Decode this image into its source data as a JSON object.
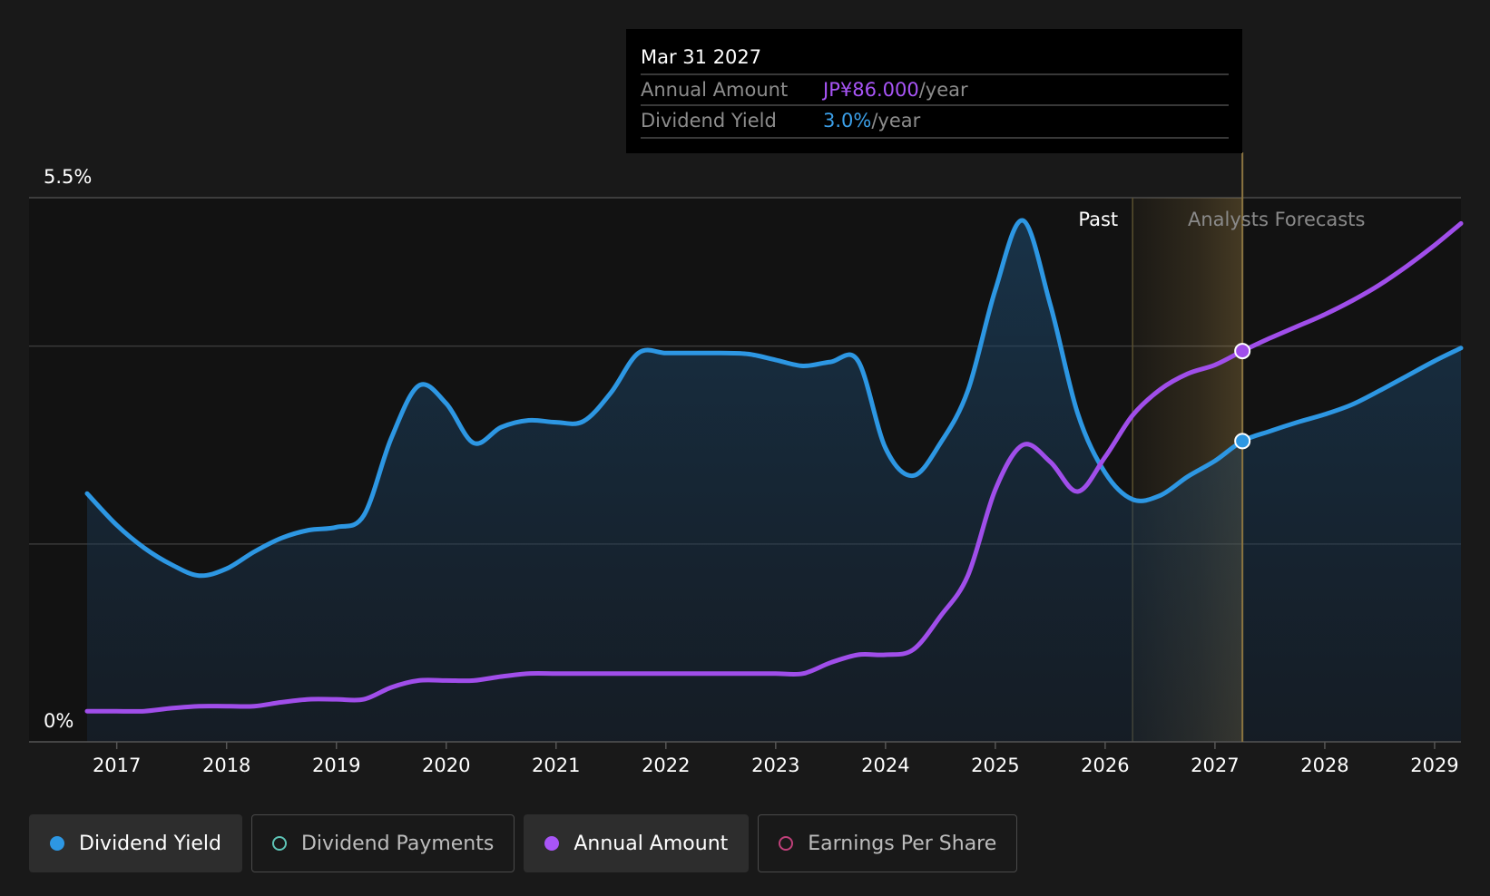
{
  "tooltip": {
    "date": "Mar 31 2027",
    "rows": [
      {
        "label": "Annual Amount",
        "value": "JP¥86.000",
        "unit": "/year",
        "color": "#a855f7"
      },
      {
        "label": "Dividend Yield",
        "value": "3.0%",
        "unit": "/year",
        "color": "#3b9fe8"
      }
    ]
  },
  "labels": {
    "past": "Past",
    "forecast": "Analysts Forecasts"
  },
  "colors": {
    "background": "#191919",
    "plot_background": "#121212",
    "dividend_yield": "#2d97e3",
    "annual_amount": "#a04eea",
    "forecast_band": "#c8a050",
    "grid": "#3a3a3a"
  },
  "legend": [
    {
      "label": "Dividend Yield",
      "color": "#2d97e3",
      "style": "filled",
      "active": true
    },
    {
      "label": "Dividend Payments",
      "color": "#5ec4b6",
      "style": "hollow",
      "active": false
    },
    {
      "label": "Annual Amount",
      "color": "#a855f7",
      "style": "filled",
      "active": true
    },
    {
      "label": "Earnings Per Share",
      "color": "#c0407a",
      "style": "hollow",
      "active": false
    }
  ],
  "chart_data": {
    "type": "area",
    "xlim": [
      2016.73,
      2029.24
    ],
    "ylim": [
      0,
      5.5
    ],
    "y_ticks": [
      {
        "value": 5.5,
        "label": "5.5%"
      },
      {
        "value": 0,
        "label": "0%"
      }
    ],
    "y_gridlines": [
      5.5,
      4.0,
      2.0
    ],
    "x_ticks": [
      2017,
      2018,
      2019,
      2020,
      2021,
      2022,
      2023,
      2024,
      2025,
      2026,
      2027,
      2028,
      2029
    ],
    "past_until": 2026.25,
    "forecast_shade": [
      2026.25,
      2027.25
    ],
    "highlight_x": 2027.25,
    "series": [
      {
        "name": "Dividend Yield",
        "key": "dividend_yield",
        "filled": true,
        "points": [
          [
            2016.73,
            2.51
          ],
          [
            2017.0,
            2.19
          ],
          [
            2017.25,
            1.96
          ],
          [
            2017.5,
            1.79
          ],
          [
            2017.75,
            1.68
          ],
          [
            2018.0,
            1.75
          ],
          [
            2018.25,
            1.92
          ],
          [
            2018.5,
            2.06
          ],
          [
            2018.75,
            2.14
          ],
          [
            2019.0,
            2.17
          ],
          [
            2019.25,
            2.29
          ],
          [
            2019.5,
            3.07
          ],
          [
            2019.75,
            3.6
          ],
          [
            2020.0,
            3.42
          ],
          [
            2020.25,
            3.02
          ],
          [
            2020.5,
            3.18
          ],
          [
            2020.75,
            3.25
          ],
          [
            2021.0,
            3.23
          ],
          [
            2021.25,
            3.24
          ],
          [
            2021.5,
            3.53
          ],
          [
            2021.75,
            3.93
          ],
          [
            2022.0,
            3.93
          ],
          [
            2022.25,
            3.93
          ],
          [
            2022.5,
            3.93
          ],
          [
            2022.75,
            3.92
          ],
          [
            2023.0,
            3.86
          ],
          [
            2023.25,
            3.8
          ],
          [
            2023.5,
            3.84
          ],
          [
            2023.75,
            3.85
          ],
          [
            2024.0,
            2.97
          ],
          [
            2024.25,
            2.69
          ],
          [
            2024.5,
            3.02
          ],
          [
            2024.75,
            3.55
          ],
          [
            2025.0,
            4.57
          ],
          [
            2025.25,
            5.27
          ],
          [
            2025.5,
            4.42
          ],
          [
            2025.75,
            3.32
          ],
          [
            2026.0,
            2.72
          ],
          [
            2026.25,
            2.45
          ],
          [
            2026.5,
            2.49
          ],
          [
            2026.75,
            2.68
          ],
          [
            2027.0,
            2.84
          ],
          [
            2027.25,
            3.04
          ],
          [
            2027.5,
            3.14
          ],
          [
            2027.75,
            3.23
          ],
          [
            2028.0,
            3.31
          ],
          [
            2028.25,
            3.41
          ],
          [
            2028.5,
            3.55
          ],
          [
            2028.75,
            3.7
          ],
          [
            2029.0,
            3.85
          ],
          [
            2029.24,
            3.98
          ]
        ]
      },
      {
        "name": "Annual Amount",
        "key": "annual_amount",
        "filled": false,
        "points": [
          [
            2016.73,
            0.31
          ],
          [
            2017.0,
            0.31
          ],
          [
            2017.25,
            0.31
          ],
          [
            2017.5,
            0.34
          ],
          [
            2017.75,
            0.36
          ],
          [
            2018.0,
            0.36
          ],
          [
            2018.25,
            0.36
          ],
          [
            2018.5,
            0.4
          ],
          [
            2018.75,
            0.43
          ],
          [
            2019.0,
            0.43
          ],
          [
            2019.25,
            0.43
          ],
          [
            2019.5,
            0.55
          ],
          [
            2019.75,
            0.62
          ],
          [
            2020.0,
            0.62
          ],
          [
            2020.25,
            0.62
          ],
          [
            2020.5,
            0.66
          ],
          [
            2020.75,
            0.69
          ],
          [
            2021.0,
            0.69
          ],
          [
            2021.25,
            0.69
          ],
          [
            2021.5,
            0.69
          ],
          [
            2021.75,
            0.69
          ],
          [
            2022.0,
            0.69
          ],
          [
            2022.25,
            0.69
          ],
          [
            2022.5,
            0.69
          ],
          [
            2022.75,
            0.69
          ],
          [
            2023.0,
            0.69
          ],
          [
            2023.25,
            0.69
          ],
          [
            2023.5,
            0.8
          ],
          [
            2023.75,
            0.88
          ],
          [
            2024.0,
            0.88
          ],
          [
            2024.25,
            0.93
          ],
          [
            2024.5,
            1.27
          ],
          [
            2024.75,
            1.68
          ],
          [
            2025.0,
            2.55
          ],
          [
            2025.25,
            3.0
          ],
          [
            2025.5,
            2.83
          ],
          [
            2025.75,
            2.53
          ],
          [
            2026.0,
            2.88
          ],
          [
            2026.25,
            3.3
          ],
          [
            2026.5,
            3.56
          ],
          [
            2026.75,
            3.72
          ],
          [
            2027.0,
            3.81
          ],
          [
            2027.25,
            3.95
          ],
          [
            2027.5,
            4.08
          ],
          [
            2027.75,
            4.2
          ],
          [
            2028.0,
            4.32
          ],
          [
            2028.25,
            4.46
          ],
          [
            2028.5,
            4.62
          ],
          [
            2028.75,
            4.81
          ],
          [
            2029.0,
            5.02
          ],
          [
            2029.24,
            5.24
          ]
        ]
      }
    ]
  }
}
